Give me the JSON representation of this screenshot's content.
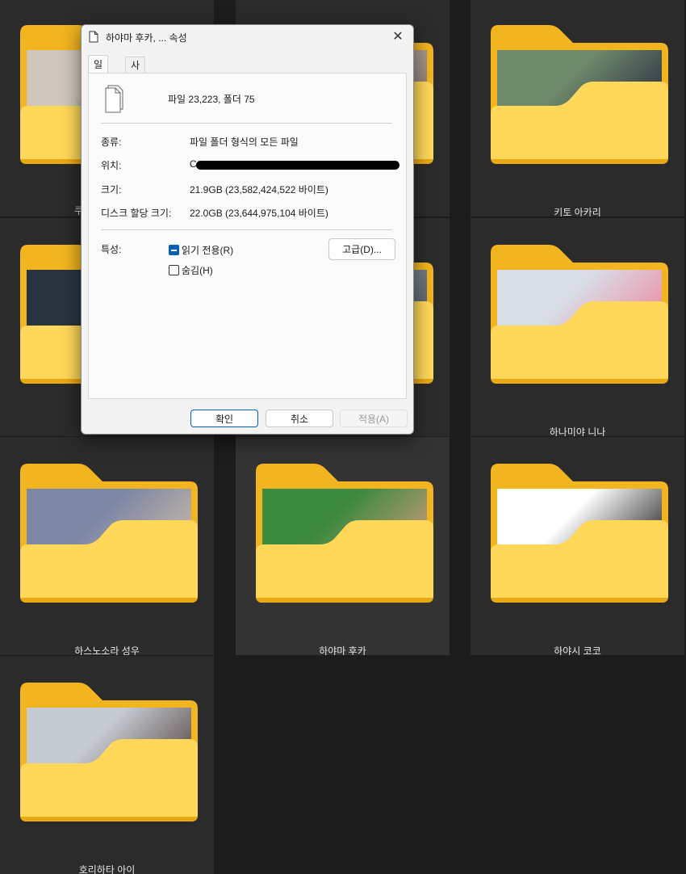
{
  "folders": [
    {
      "label": "",
      "selected": false
    },
    {
      "label": "",
      "selected": false
    },
    {
      "label": "키토 아카리",
      "selected": false
    },
    {
      "label": "",
      "selected": false
    },
    {
      "label": "",
      "selected": false
    },
    {
      "label": "하나미야 니나",
      "selected": false
    },
    {
      "label": "하스노소라 성우",
      "selected": false
    },
    {
      "label": "하야마 후카",
      "selected": true
    },
    {
      "label": "하야시 코코",
      "selected": false
    },
    {
      "label": "호리하타 아이",
      "selected": false
    }
  ],
  "partial_label": "쿠",
  "colors": {
    "folder_back": "#f2b51f",
    "folder_front": "#ffd85a",
    "background": "#1c1c1c",
    "tile": "#2b2b2b",
    "accent": "#005fb8"
  },
  "dialog": {
    "title": "하야마 후카, ... 속성",
    "close_icon": "✕",
    "tabs": [
      "일반",
      "사용자 지정"
    ],
    "summary": "파일 23,223, 폴더 75",
    "rows": [
      {
        "label": "종류:",
        "value": "파일 폴더 형식의 모든 파일"
      },
      {
        "label": "위치:",
        "value": "C"
      },
      {
        "label": "크기:",
        "value": "21.9GB (23,582,424,522 바이트)"
      },
      {
        "label": "디스크 할당 크기:",
        "value": "22.0GB (23,644,975,104 바이트)"
      }
    ],
    "attributes_label": "특성:",
    "readonly_label": "읽기 전용(R)",
    "hidden_label": "숨김(H)",
    "advanced_button": "고급(D)...",
    "ok_button": "확인",
    "cancel_button": "취소",
    "apply_button": "적용(A)"
  }
}
